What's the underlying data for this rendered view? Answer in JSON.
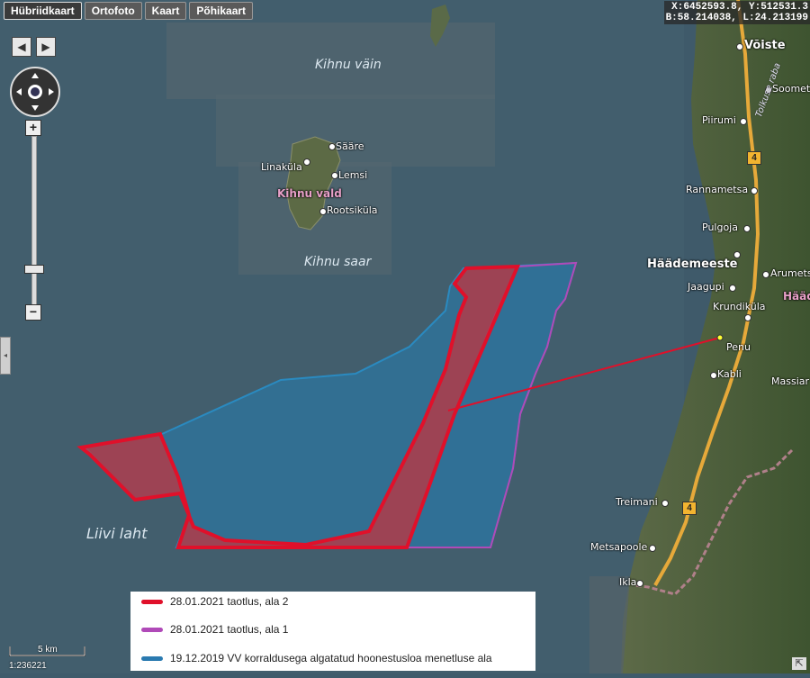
{
  "tabs": [
    {
      "label": "Hübriidkaart",
      "active": true
    },
    {
      "label": "Ortofoto",
      "active": false
    },
    {
      "label": "Kaart",
      "active": false
    },
    {
      "label": "Põhikaart",
      "active": false
    }
  ],
  "coords": {
    "xy": "X:6452593.8, Y:512531.3",
    "bl": "B:58.214038, L:24.213199"
  },
  "labels": {
    "kihnu_vain": "Kihnu väin",
    "kihnu_saar": "Kihnu saar",
    "kihnu_vald": "Kihnu vald",
    "liivi_laht": "Liivi laht",
    "saare": "Sääre",
    "linakyla": "Linaküla",
    "lemsi": "Lemsi",
    "rootsikyla": "Rootsiküla",
    "voiste": "Võiste",
    "soometsa": "Soomet",
    "piirumi": "Piirumi",
    "tolkuse_raba": "Tolkuse raba",
    "rannametsa": "Rannametsa",
    "pulgoja": "Pulgoja",
    "haademeeste": "Häädemeeste",
    "haade_vald": "Hääd",
    "arumetsa": "Arumets",
    "jaagupi": "Jaagupi",
    "krundikyla": "Krundiküla",
    "penu": "Penu",
    "kabli": "Kabli",
    "massiaru": "Massiar",
    "treimani": "Treimani",
    "metsapoole": "Metsapoole",
    "ikla": "Ikla",
    "road_4a": "4",
    "road_4b": "4"
  },
  "legend": [
    {
      "label": "28.01.2021 taotlus, ala 2",
      "color": "#e0102a"
    },
    {
      "label": "28.01.2021 taotlus, ala 1",
      "color": "#b04ab8"
    },
    {
      "label": "19.12.2019 VV korraldusega algatatud hoonestusloa menetluse ala",
      "color": "#2a7ab0"
    }
  ],
  "scale": {
    "label": "5 km",
    "ratio": "1:236221"
  },
  "controls": {
    "left": "◀",
    "right": "▶",
    "zoom_in": "+",
    "zoom_out": "−",
    "collapse": "◂",
    "corner": "⇱"
  },
  "colors": {
    "sea": "#3f5b6b",
    "land": "#4a5f3a",
    "area2": "#e0102a",
    "area1": "#b04ab8",
    "area_2019": "#2a7ab0"
  }
}
